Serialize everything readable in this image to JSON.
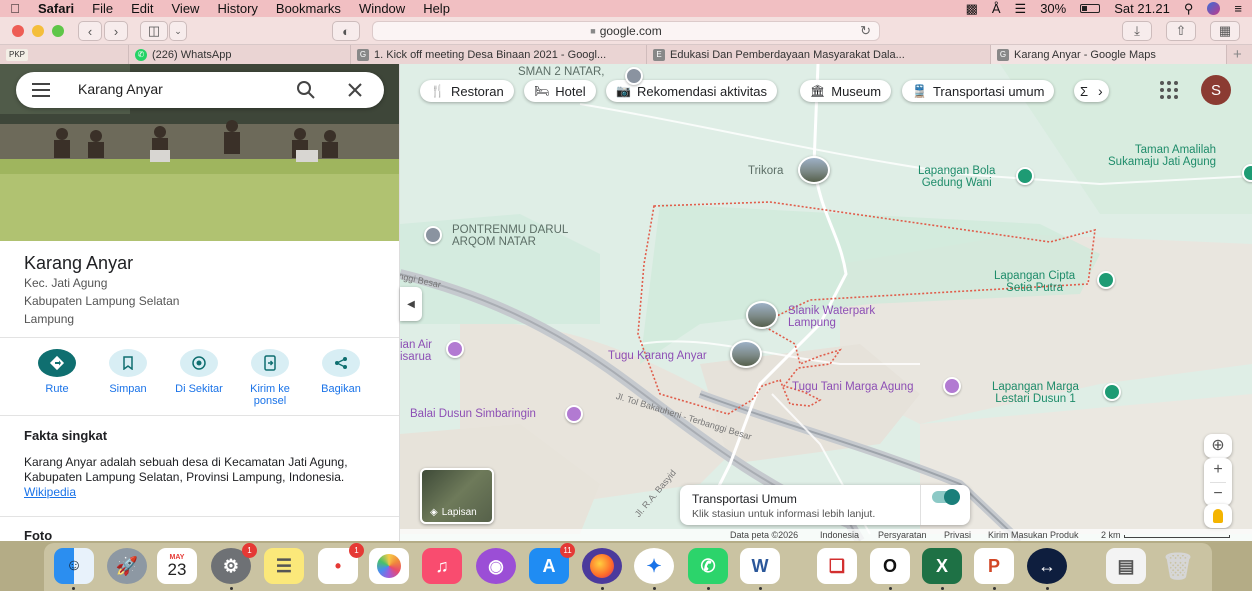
{
  "menubar": {
    "app": "Safari",
    "items": [
      "File",
      "Edit",
      "View",
      "History",
      "Bookmarks",
      "Window",
      "Help"
    ],
    "battery": "30%",
    "clock": "Sat 21.21"
  },
  "toolbar": {
    "url": "google.com"
  },
  "tabs": [
    {
      "label": "PKP",
      "favicon": "PKP"
    },
    {
      "label": "(226) WhatsApp",
      "favicon": "W"
    },
    {
      "label": "1. Kick off meeting Desa Binaan 2021 - Googl...",
      "favicon": "G"
    },
    {
      "label": "Edukasi Dan Pemberdayaan Masyarakat Dala...",
      "favicon": "E"
    },
    {
      "label": "Karang Anyar - Google Maps",
      "favicon": "G"
    }
  ],
  "panel": {
    "search_value": "Karang Anyar",
    "place_name": "Karang Anyar",
    "address_lines": [
      "Kec. Jati Agung",
      "Kabupaten Lampung Selatan",
      "Lampung"
    ],
    "actions": [
      {
        "label": "Rute",
        "icon": "directions-icon"
      },
      {
        "label": "Simpan",
        "icon": "bookmark-icon"
      },
      {
        "label": "Di Sekitar",
        "icon": "nearby-icon"
      },
      {
        "label": "Kirim ke ponsel",
        "icon": "send-to-phone-icon"
      },
      {
        "label": "Bagikan",
        "icon": "share-icon"
      }
    ],
    "facts_title": "Fakta singkat",
    "facts_text": "Karang Anyar adalah sebuah desa di Kecamatan Jati Agung, Kabupaten Lampung Selatan, Provinsi Lampung, Indonesia.",
    "facts_link": "Wikipedia",
    "photos_title": "Foto"
  },
  "map": {
    "chips": [
      "Restoran",
      "Hotel",
      "Rekomendasi aktivitas",
      "Museum",
      "Transportasi umum"
    ],
    "chip_overflow": "Σ",
    "avatar_letter": "S",
    "labels": {
      "sman": "SMAN 2 NATAR,",
      "trikora": "Trikora",
      "lapangan_bola": "Lapangan Bola\nGedung Wani",
      "taman": "Taman Amalilah\nSukamaju Jati Agung",
      "pontrenmu": "PONTRENMU DARUL\nARQOM NATAR",
      "lapangan_cipta": "Lapangan Cipta\nSetia Putra",
      "slanik": "Slanik Waterpark\nLampung",
      "tugu_karang": "Tugu Karang Anyar",
      "tugu_tani": "Tugu Tani Marga Agung",
      "lapangan_marga": "Lapangan Marga\nLestari Dusun 1",
      "balai": "Balai Dusun Simbaringin",
      "air": "ian Air\nisarua",
      "road_besar": "Jl. Tol Bakauheni - Terbanggi Besar",
      "road_besar_left": "nggi Besar",
      "road_basyid": "Jl. R.A. Basyid"
    },
    "layers_label": "Lapisan",
    "transit_title": "Transportasi Umum",
    "transit_subtitle": "Klik stasiun untuk informasi lebih lanjut.",
    "footer": {
      "data": "Data peta ©2026",
      "country": "Indonesia",
      "terms": "Persyaratan",
      "privacy": "Privasi",
      "feedback": "Kirim Masukan Produk",
      "scale": "2 km"
    }
  },
  "dock": {
    "calendar_month": "MAY",
    "calendar_day": "23",
    "badges": {
      "settings": "1",
      "reminders": "1",
      "appstore": "11"
    }
  }
}
